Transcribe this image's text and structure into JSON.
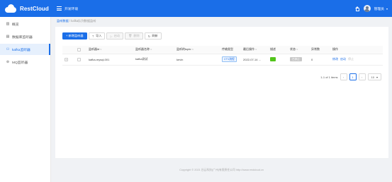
{
  "header": {
    "brand": "RestCloud",
    "env": "开发环境",
    "user": "管理员",
    "caret": "▾"
  },
  "sidebar": {
    "items": [
      {
        "label": "概览",
        "icon": "chart-icon",
        "glyph": "▥"
      },
      {
        "label": "数据库监听器",
        "icon": "database-icon",
        "glyph": "▤"
      },
      {
        "label": "kafka监听器",
        "icon": "kafka-icon",
        "glyph": "⚇"
      },
      {
        "label": "MQ监听器",
        "icon": "mq-icon",
        "glyph": "⊚"
      }
    ]
  },
  "breadcrumb": {
    "root": "监听数据",
    "sep": " / ",
    "current": "kafka队列数据监听"
  },
  "toolbar": {
    "add": "+ 新增监听器",
    "import": "导入",
    "start": "启动",
    "delete": "删除",
    "refresh": "刷新"
  },
  "table": {
    "columns": [
      "",
      "",
      "监听器id",
      "监听器名称",
      "监听的topic",
      "传输类型",
      "最后操作",
      "描述",
      "状态",
      "异常数",
      "操作"
    ],
    "rows": [
      {
        "expand": "+",
        "id": "kafka-mysql-001",
        "name": "kafka测试",
        "topic": "kevin",
        "type": "CT1流程",
        "last": "2022-07-14 ...",
        "desc": "",
        "desc_status": "",
        "status": "已停止",
        "errors": "0",
        "ops": [
          "修改",
          "启动",
          "停止"
        ]
      }
    ]
  },
  "pagination": {
    "summary": "1-1 of 1 items",
    "prev": "‹",
    "page": "1",
    "next": "›",
    "size": "10",
    "size_caret": "▾"
  },
  "footer": {
    "text": "Copyright © 2021   谷云科技(广州)有限责任公司   http://www.restcloud.cn"
  },
  "colors": {
    "primary": "#1a6ee8",
    "success": "#52c41a",
    "muted": "#c8c8c8"
  }
}
